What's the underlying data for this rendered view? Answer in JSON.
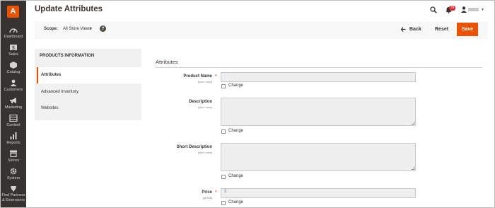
{
  "sidebar": {
    "logo_letter": "A",
    "items": [
      {
        "label": "Dashboard",
        "icon": "dashboard-icon"
      },
      {
        "label": "Sales",
        "icon": "dollar-icon"
      },
      {
        "label": "Catalog",
        "icon": "cube-icon"
      },
      {
        "label": "Customers",
        "icon": "users-icon"
      },
      {
        "label": "Marketing",
        "icon": "megaphone-icon"
      },
      {
        "label": "Content",
        "icon": "layout-icon"
      },
      {
        "label": "Reports",
        "icon": "bar-chart-icon"
      },
      {
        "label": "Stores",
        "icon": "store-icon"
      },
      {
        "label": "System",
        "icon": "gear-icon"
      },
      {
        "label": "Find Partners",
        "icon": "partners-icon"
      },
      {
        "label": "& Extensions",
        "icon": ""
      }
    ]
  },
  "header": {
    "title": "Update Attributes",
    "notification_count": "39",
    "accent_color": "#eb5202"
  },
  "actionbar": {
    "scope_label": "Scope:",
    "scope_value": "All Store Views",
    "help": "?",
    "back_label": "Back",
    "reset_label": "Reset",
    "save_label": "Save"
  },
  "tabs": {
    "heading": "PRODUCTS INFORMATION",
    "items": [
      "Attributes",
      "Advanced Inventory",
      "Websites"
    ],
    "active": "Attributes"
  },
  "form": {
    "section_title": "Attributes",
    "change_label": "Change",
    "fields": [
      {
        "label": "Product Name",
        "scope": "[store view]",
        "required": true,
        "value": ""
      },
      {
        "label": "Description",
        "scope": "[store view]",
        "required": false,
        "value": ""
      },
      {
        "label": "Short Description",
        "scope": "[store view]",
        "required": false,
        "value": ""
      },
      {
        "label": "Price",
        "scope": "[global]",
        "required": true,
        "value": "",
        "placeholder": "$"
      }
    ]
  }
}
